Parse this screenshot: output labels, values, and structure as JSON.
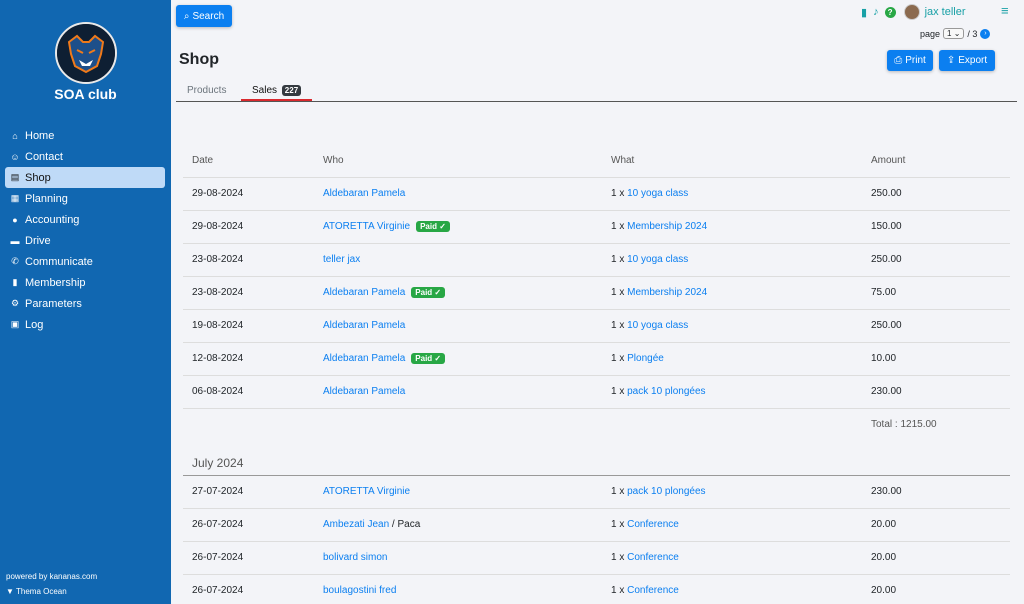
{
  "sidebar": {
    "club_name": "SOA club",
    "items": [
      {
        "label": "Home",
        "icon": "home-icon",
        "glyph": "⌂",
        "active": false
      },
      {
        "label": "Contact",
        "icon": "users-icon",
        "glyph": "☺",
        "active": false
      },
      {
        "label": "Shop",
        "icon": "store-icon",
        "glyph": "▤",
        "active": true
      },
      {
        "label": "Planning",
        "icon": "calendar-icon",
        "glyph": "▦",
        "active": false
      },
      {
        "label": "Accounting",
        "icon": "piggy-bank-icon",
        "glyph": "●",
        "active": false
      },
      {
        "label": "Drive",
        "icon": "drive-icon",
        "glyph": "▬",
        "active": false
      },
      {
        "label": "Communicate",
        "icon": "broadcast-icon",
        "glyph": "✆",
        "active": false
      },
      {
        "label": "Membership",
        "icon": "id-card-icon",
        "glyph": "▮",
        "active": false
      },
      {
        "label": "Parameters",
        "icon": "gear-icon",
        "glyph": "⚙",
        "active": false
      },
      {
        "label": "Log",
        "icon": "book-icon",
        "glyph": "▣",
        "active": false
      }
    ],
    "powered": "powered by kananas.com",
    "theme": "Thema Ocean"
  },
  "header": {
    "search_label": "Search",
    "username": "jax teller",
    "page_label": "page",
    "page_value": "1",
    "page_total": "/ 3",
    "print_label": "Print",
    "export_label": "Export",
    "title": "Shop"
  },
  "tabs": {
    "products": "Products",
    "sales": "Sales",
    "sales_count": "227"
  },
  "table": {
    "headers": [
      "Date",
      "Who",
      "What",
      "Amount"
    ],
    "paid_label": "Paid ✓",
    "rows_aug": [
      {
        "date": "29-08-2024",
        "who": "Aldebaran Pamela",
        "paid": false,
        "qty": "1 x",
        "what": "10 yoga class",
        "amount": "250.00"
      },
      {
        "date": "29-08-2024",
        "who": "ATORETTA Virginie",
        "paid": true,
        "qty": "1 x",
        "what": "Membership 2024",
        "amount": "150.00"
      },
      {
        "date": "23-08-2024",
        "who": "teller jax",
        "paid": false,
        "qty": "1 x",
        "what": "10 yoga class",
        "amount": "250.00"
      },
      {
        "date": "23-08-2024",
        "who": "Aldebaran Pamela",
        "paid": true,
        "qty": "1 x",
        "what": "Membership 2024",
        "amount": "75.00"
      },
      {
        "date": "19-08-2024",
        "who": "Aldebaran Pamela",
        "paid": false,
        "qty": "1 x",
        "what": "10 yoga class",
        "amount": "250.00"
      },
      {
        "date": "12-08-2024",
        "who": "Aldebaran Pamela",
        "paid": true,
        "qty": "1 x",
        "what": "Plongée",
        "amount": "10.00"
      },
      {
        "date": "06-08-2024",
        "who": "Aldebaran Pamela",
        "paid": false,
        "qty": "1 x",
        "what": "pack 10 plongées",
        "amount": "230.00"
      }
    ],
    "total": "Total : 1215.00",
    "month_label": "July 2024",
    "rows_jul": [
      {
        "date": "27-07-2024",
        "who": "ATORETTA Virginie",
        "extra": "",
        "qty": "1 x",
        "what": "pack 10 plongées",
        "amount": "230.00"
      },
      {
        "date": "26-07-2024",
        "who": "Ambezati Jean",
        "extra": " / Paca",
        "qty": "1 x",
        "what": "Conference",
        "amount": "20.00"
      },
      {
        "date": "26-07-2024",
        "who": "bolivard simon",
        "extra": "",
        "qty": "1 x",
        "what": "Conference",
        "amount": "20.00"
      },
      {
        "date": "26-07-2024",
        "who": "boulagostini fred",
        "extra": "",
        "qty": "1 x",
        "what": "Conference",
        "amount": "20.00"
      }
    ]
  }
}
